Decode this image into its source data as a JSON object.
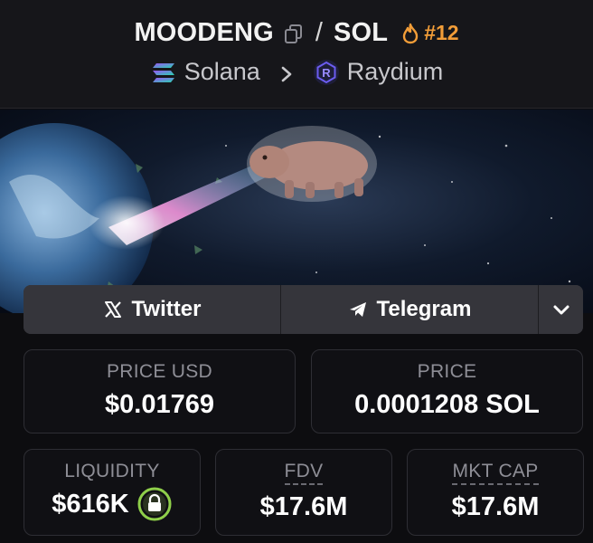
{
  "header": {
    "base_token": "MOODENG",
    "separator": "/",
    "quote_token": "SOL",
    "rank": "#12",
    "chain": "Solana",
    "dex": "Raydium",
    "icons": {
      "copy": "copy-icon",
      "rank": "flame-icon",
      "chain": "solana-logo-icon",
      "breadcrumb_sep": "chevron-right-icon",
      "dex": "raydium-logo-icon"
    },
    "colors": {
      "rank": "#f29d38",
      "dex_icon": "#5a4bd6"
    }
  },
  "socials": {
    "twitter_label": "Twitter",
    "telegram_label": "Telegram",
    "more_icon": "chevron-down-icon"
  },
  "stats": {
    "price_usd_label": "PRICE USD",
    "price_usd_value": "$0.01769",
    "price_label": "PRICE",
    "price_value": "0.0001208 SOL",
    "liquidity_label": "LIQUIDITY",
    "liquidity_value": "$616K",
    "liquidity_icon": "lock-icon",
    "fdv_label": "FDV",
    "fdv_value": "$17.6M",
    "mktcap_label": "MKT CAP",
    "mktcap_value": "$17.6M"
  }
}
